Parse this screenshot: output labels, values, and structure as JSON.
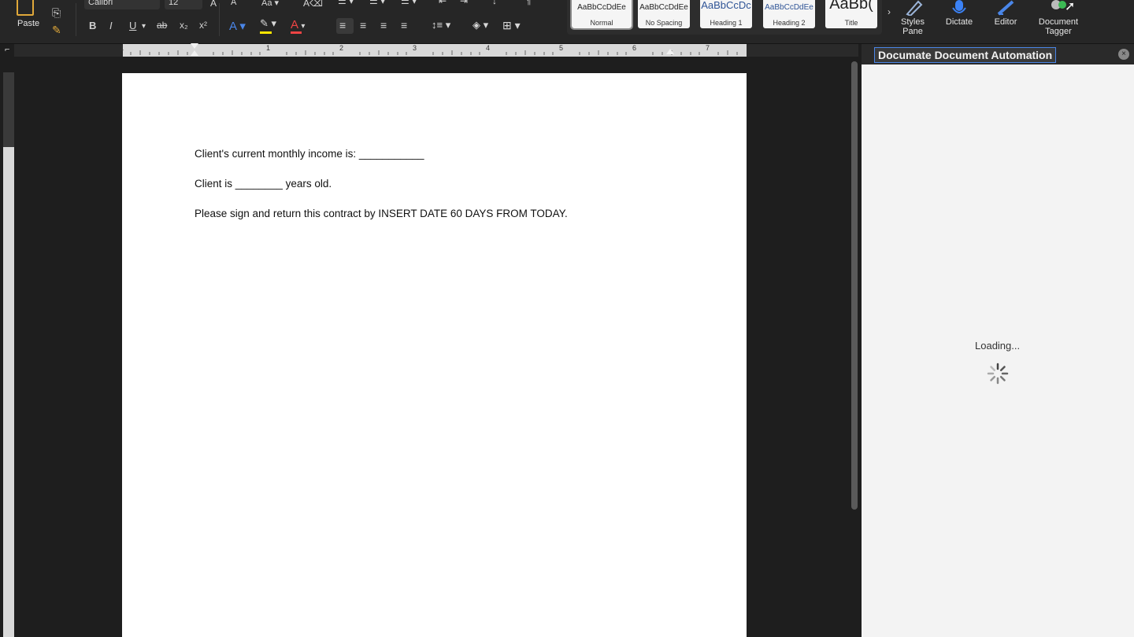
{
  "ribbon": {
    "paste_label": "Paste",
    "font_name": "Calibri",
    "font_size": "12",
    "format_buttons": [
      "B",
      "I",
      "U",
      "ab",
      "x₂",
      "x²"
    ],
    "styles": [
      {
        "sample": "AaBbCcDdEe",
        "name": "Normal"
      },
      {
        "sample": "AaBbCcDdEe",
        "name": "No Spacing"
      },
      {
        "sample": "AaBbCcDc",
        "name": "Heading 1"
      },
      {
        "sample": "AaBbCcDdEe",
        "name": "Heading 2"
      },
      {
        "sample": "AaBb(",
        "name": "Title"
      }
    ],
    "styles_pane_label_1": "Styles",
    "styles_pane_label_2": "Pane",
    "dictate_label": "Dictate",
    "editor_label": "Editor",
    "tagger_label_1": "Document",
    "tagger_label_2": "Tagger"
  },
  "ruler": {
    "numbers": [
      "1",
      "1",
      "2",
      "3",
      "4",
      "5",
      "6",
      "7"
    ]
  },
  "document": {
    "lines": [
      "Client's current monthly income is: ___________",
      "Client is ________ years old.",
      "Please sign and return this contract by INSERT DATE 60 DAYS FROM TODAY."
    ]
  },
  "pane": {
    "title": "Documate Document Automation",
    "close": "×",
    "loading": "Loading..."
  },
  "colors": {
    "accent": "#4a86e8",
    "paste_icon": "#e0a83a"
  }
}
